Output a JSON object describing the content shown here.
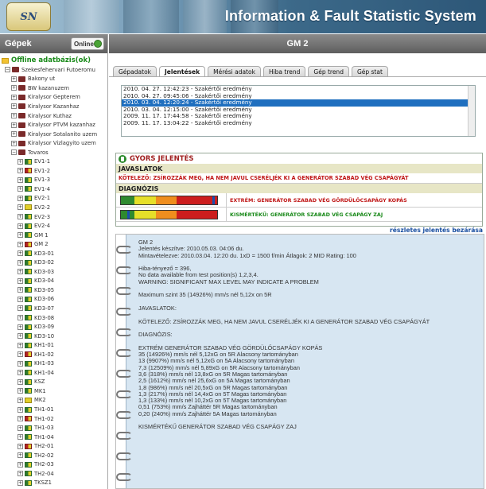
{
  "header": {
    "logo_text": "SN",
    "title": "Information & Fault Statistic System"
  },
  "left_panel": {
    "title": "Gépek",
    "online_label": "Online",
    "root": "Offline adatbázis(ok)",
    "site": "Szekesfehervari Futoeromu",
    "folders": [
      "Bakony ut",
      "BW kazanuzem",
      "Kiralysor Gepterem",
      "Kiralysor Kazanhaz",
      "Kiralysor Kuthaz",
      "Kiralysor PTVM kazanhaz",
      "Kiralysor Sotalanito uzem",
      "Kiralysor Vizlagyito uzem",
      "Tovaros"
    ],
    "machines": [
      {
        "label": "EV1-1",
        "status": "g"
      },
      {
        "label": "EV1-2",
        "status": "r"
      },
      {
        "label": "EV1-3",
        "status": "g"
      },
      {
        "label": "EV1-4",
        "status": "g"
      },
      {
        "label": "EV2-1",
        "status": "g"
      },
      {
        "label": "EV2-2",
        "status": "y"
      },
      {
        "label": "EV2-3",
        "status": "g"
      },
      {
        "label": "EV2-4",
        "status": "g"
      },
      {
        "label": "GM 1",
        "status": "g"
      },
      {
        "label": "GM 2",
        "status": "r"
      },
      {
        "label": "KD3-01",
        "status": "g"
      },
      {
        "label": "KD3-02",
        "status": "g"
      },
      {
        "label": "KD3-03",
        "status": "g"
      },
      {
        "label": "KD3-04",
        "status": "g"
      },
      {
        "label": "KD3-05",
        "status": "g"
      },
      {
        "label": "KD3-06",
        "status": "g"
      },
      {
        "label": "KD3-07",
        "status": "g"
      },
      {
        "label": "KD3-08",
        "status": "g"
      },
      {
        "label": "KD3-09",
        "status": "g"
      },
      {
        "label": "KD3-10",
        "status": "g"
      },
      {
        "label": "KH1-01",
        "status": "g"
      },
      {
        "label": "KH1-02",
        "status": "r"
      },
      {
        "label": "KH1-03",
        "status": "g"
      },
      {
        "label": "KH1-04",
        "status": "g"
      },
      {
        "label": "KSZ",
        "status": "g"
      },
      {
        "label": "MK1",
        "status": "g"
      },
      {
        "label": "MK2",
        "status": "y"
      },
      {
        "label": "TH1-01",
        "status": "g"
      },
      {
        "label": "TH1-02",
        "status": "r"
      },
      {
        "label": "TH1-03",
        "status": "g"
      },
      {
        "label": "TH1-04",
        "status": "g"
      },
      {
        "label": "TH2-01",
        "status": "r"
      },
      {
        "label": "TH2-02",
        "status": "g"
      },
      {
        "label": "TH2-03",
        "status": "g"
      },
      {
        "label": "TH2-04",
        "status": "g"
      },
      {
        "label": "TKSZ1",
        "status": "g"
      },
      {
        "label": "TKSZ2",
        "status": "g"
      }
    ]
  },
  "main": {
    "title": "GM 2",
    "tabs": [
      "Gépadatok",
      "Jelentések",
      "Mérési adatok",
      "Hiba trend",
      "Gép trend",
      "Gép stat"
    ],
    "active_tab": 1,
    "reports": [
      "2010. 04. 27. 12:42:23 - Szakértői eredmény",
      "2010. 04. 27. 09:45:06 - Szakértői eredmény",
      "2010. 03. 04. 12:20:24 - Szakértői eredmény",
      "2010. 03. 04. 12:15:00 - Szakértői eredmény",
      "2009. 11. 17. 17:44:58 - Szakértői eredmény",
      "2009. 11. 17. 13:04:22 - Szakértői eredmény"
    ],
    "selected_report": 2,
    "quick": {
      "title": "GYORS JELENTÉS",
      "recommendations_label": "JAVASLATOK",
      "mandatory": "KÖTELEZŐ: ZSÍROZZÁK MEG, HA NEM JAVUL CSERÉLJÉK KI A GENERÁTOR SZABAD VÉG CSAPÁGYÁT",
      "diagnosis_label": "DIAGNÓZIS",
      "diagnoses": [
        {
          "text": "EXTRÉM: GENERÁTOR SZABAD VÉG GÖRDÜLŐCSAPÁGY KOPÁS",
          "severity": "red",
          "level": 0.97
        },
        {
          "text": "KISMÉRTÉKŰ: GENERÁTOR SZABAD VÉG CSAPÁGY ZAJ",
          "severity": "green",
          "level": 0.08
        }
      ]
    },
    "close_link": "részletes jelentés bezárása",
    "detail_lines": [
      "GM 2",
      "Jelentés készítve: 2010.05.03. 04:06 du.",
      "Mintavételezve: 2010.03.04. 12:20 du. 1xD = 1500 f/min Átlagok: 2 MID Rating: 100",
      "",
      "Hiba-tényező = 396,",
      "No data available from test position(s) 1,2,3,4.",
      "WARNING: SIGNIFICANT MAX LEVEL MAY INDICATE A PROBLEM",
      "",
      "Maximum szint 35 (14926%) mm/s nél 5,12x on 5R",
      "",
      "JAVASLATOK:",
      "",
      "KÖTELEZŐ: ZSÍROZZÁK MEG, HA NEM JAVUL CSERÉLJÉK KI A GENERÁTOR SZABAD VÉG CSAPÁGYÁT",
      "",
      "DIAGNÓZIS:",
      "",
      "EXTRÉM GENERÁTOR SZABAD VÉG GÖRDÜLŐCSAPÁGY KOPÁS",
      "35 (14926%) mm/s nél 5,12xG on 5R Alacsony tartományban",
      "13 (9907%) mm/s nél 5,12xG on 5A Alacsony tartományban",
      "7,3 (12509%) mm/s nél 5,89xG on 5R Alacsony tartományban",
      "3,6 (318%) mm/s nél 13,8xG on 5R Magas tartományban",
      "2,5 (1612%) mm/s nél 25,6xG on 5A Magas tartományban",
      "1,8 (986%) mm/s nél 20,5xG on 5R Magas tartományban",
      "1,3 (217%) mm/s nél 14,4xG on 5T Magas tartományban",
      "1,3 (133%) mm/s nél 10,2xG on 5T Magas tartományban",
      "0,51 (753%) mm/s Zajháttér 5R Magas tartományban",
      "0,20 (240%) mm/s Zajháttér 5A Magas tartományban",
      "",
      "KISMÉRTÉKŰ GENERÁTOR SZABAD VÉG CSAPÁGY ZAJ"
    ]
  }
}
